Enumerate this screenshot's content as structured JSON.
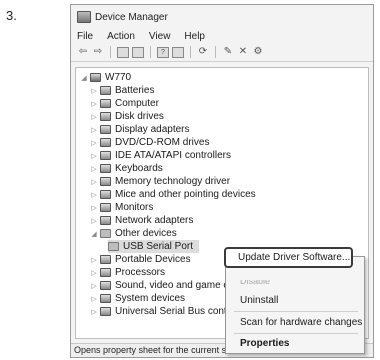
{
  "step_number": "3.",
  "window": {
    "title": "Device Manager",
    "menu": [
      "File",
      "Action",
      "View",
      "Help"
    ],
    "toolbar_icons": [
      "back-icon",
      "forward-icon",
      "properties-icon",
      "view-icon",
      "help-icon",
      "monitor-icon",
      "update-icon",
      "uninstall-icon",
      "disable-icon",
      "scan-icon"
    ]
  },
  "tree": {
    "root": "W770",
    "nodes": [
      "Batteries",
      "Computer",
      "Disk drives",
      "Display adapters",
      "DVD/CD-ROM drives",
      "IDE ATA/ATAPI controllers",
      "Keyboards",
      "Memory technology driver",
      "Mice and other pointing devices",
      "Monitors",
      "Network adapters",
      "Other devices",
      "USB Serial Port",
      "Portable Devices",
      "Processors",
      "Sound, video and game controllers",
      "System devices",
      "Universal Serial Bus controllers"
    ]
  },
  "context_menu": {
    "update": "Update Driver Software...",
    "disable": "Disable",
    "uninstall": "Uninstall",
    "scan": "Scan for hardware changes",
    "properties": "Properties"
  },
  "status_text": "Opens property sheet for the current selection."
}
